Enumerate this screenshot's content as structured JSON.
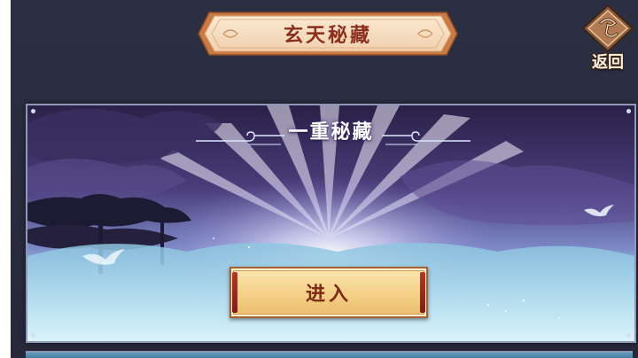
{
  "header": {
    "title": "玄天秘藏",
    "back_label": "返回"
  },
  "treasure_card": {
    "title": "一重秘藏",
    "enter_label": "进入"
  },
  "colors": {
    "background": "#2a2c3f",
    "plaque_fill": "#f6dcc0",
    "plaque_border": "#b5683a",
    "title_text": "#8b2e1c",
    "button_fill": "#f4cf86",
    "button_text": "#7a2a17",
    "card_border": "#8e98b8"
  },
  "icons": {
    "back": "scroll-back-icon",
    "crane": "crane-icon"
  }
}
